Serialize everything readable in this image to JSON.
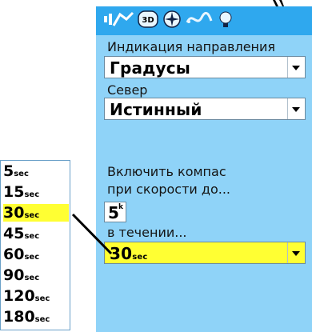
{
  "status_icons": [
    "status-bar-icon",
    "disc-icon",
    "compass-icon",
    "route-icon",
    "backlight-icon"
  ],
  "heading_display": {
    "label": "Индикация направления",
    "value": "Градусы"
  },
  "north_reference": {
    "label": "Север",
    "value": "Истинный"
  },
  "compass_enable": {
    "label_line1": "Включить компас",
    "label_line2": "при скорости до...",
    "speed_value": "5",
    "speed_unit": "k"
  },
  "duration": {
    "label": "в течении...",
    "value": "30",
    "unit": "sec"
  },
  "options": [
    {
      "value": "5",
      "unit": "sec"
    },
    {
      "value": "15",
      "unit": "sec"
    },
    {
      "value": "30",
      "unit": "sec"
    },
    {
      "value": "45",
      "unit": "sec"
    },
    {
      "value": "60",
      "unit": "sec"
    },
    {
      "value": "90",
      "unit": "sec"
    },
    {
      "value": "120",
      "unit": "sec"
    },
    {
      "value": "180",
      "unit": "sec"
    }
  ],
  "selected_option_index": 2,
  "colors": {
    "screen_bg": "#8fd3f8",
    "status_bar": "#2fa8ee",
    "highlight": "#ffff33"
  }
}
